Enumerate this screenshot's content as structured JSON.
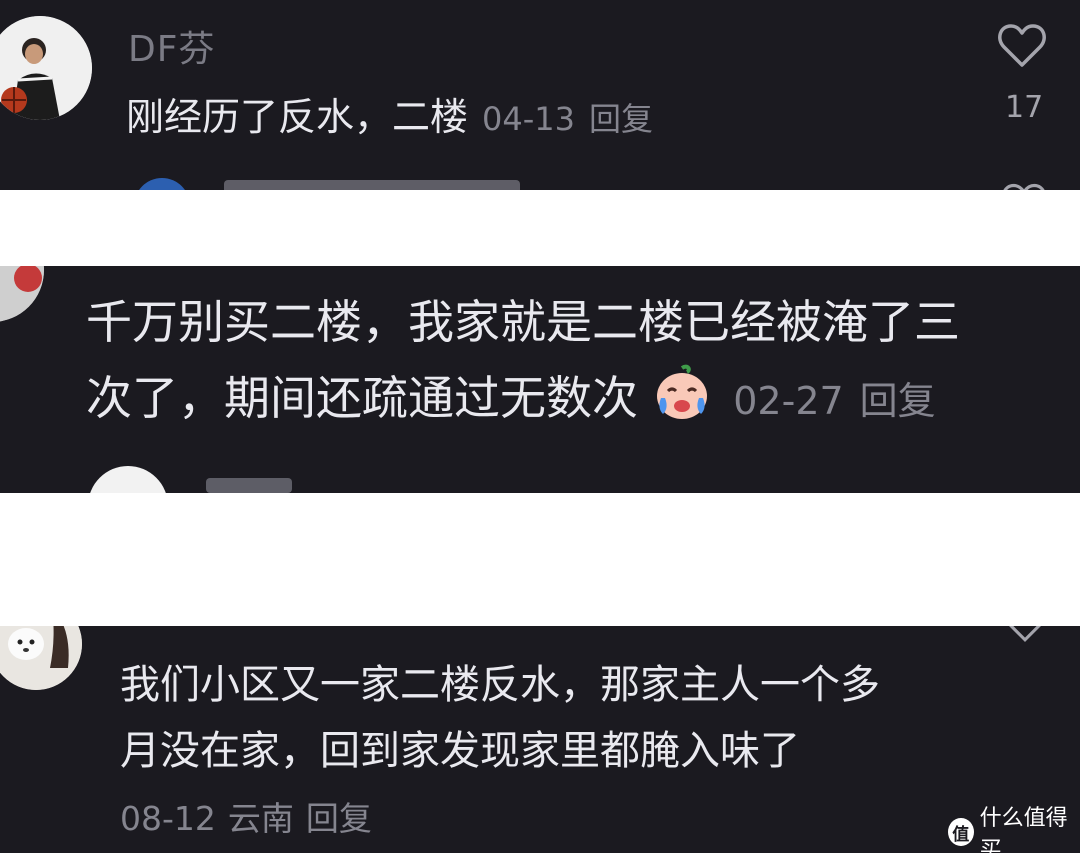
{
  "comments": [
    {
      "username": "DF芬",
      "text": "刚经历了反水，二楼",
      "date": "04-13",
      "reply": "回复",
      "likes": "17"
    },
    {
      "line1": "千万别买二楼，我家就是二楼已经被淹了三",
      "line2": "次了，期间还疏通过无数次",
      "emoji": "crying-face-emoji",
      "date": "02-27",
      "reply": "回复"
    },
    {
      "line1": "我们小区又一家二楼反水，那家主人一个多",
      "line2": "月没在家，回到家发现家里都腌入味了",
      "date": "08-12",
      "location": "云南",
      "reply": "回复"
    }
  ],
  "watermark": {
    "label": "什么值得买",
    "icon": "zhi-logo-icon"
  },
  "colors": {
    "panel_bg": "#1b1a20",
    "divider_bg": "#ffffff",
    "comment_text": "#e9e9ef",
    "meta_text": "#85858f"
  }
}
